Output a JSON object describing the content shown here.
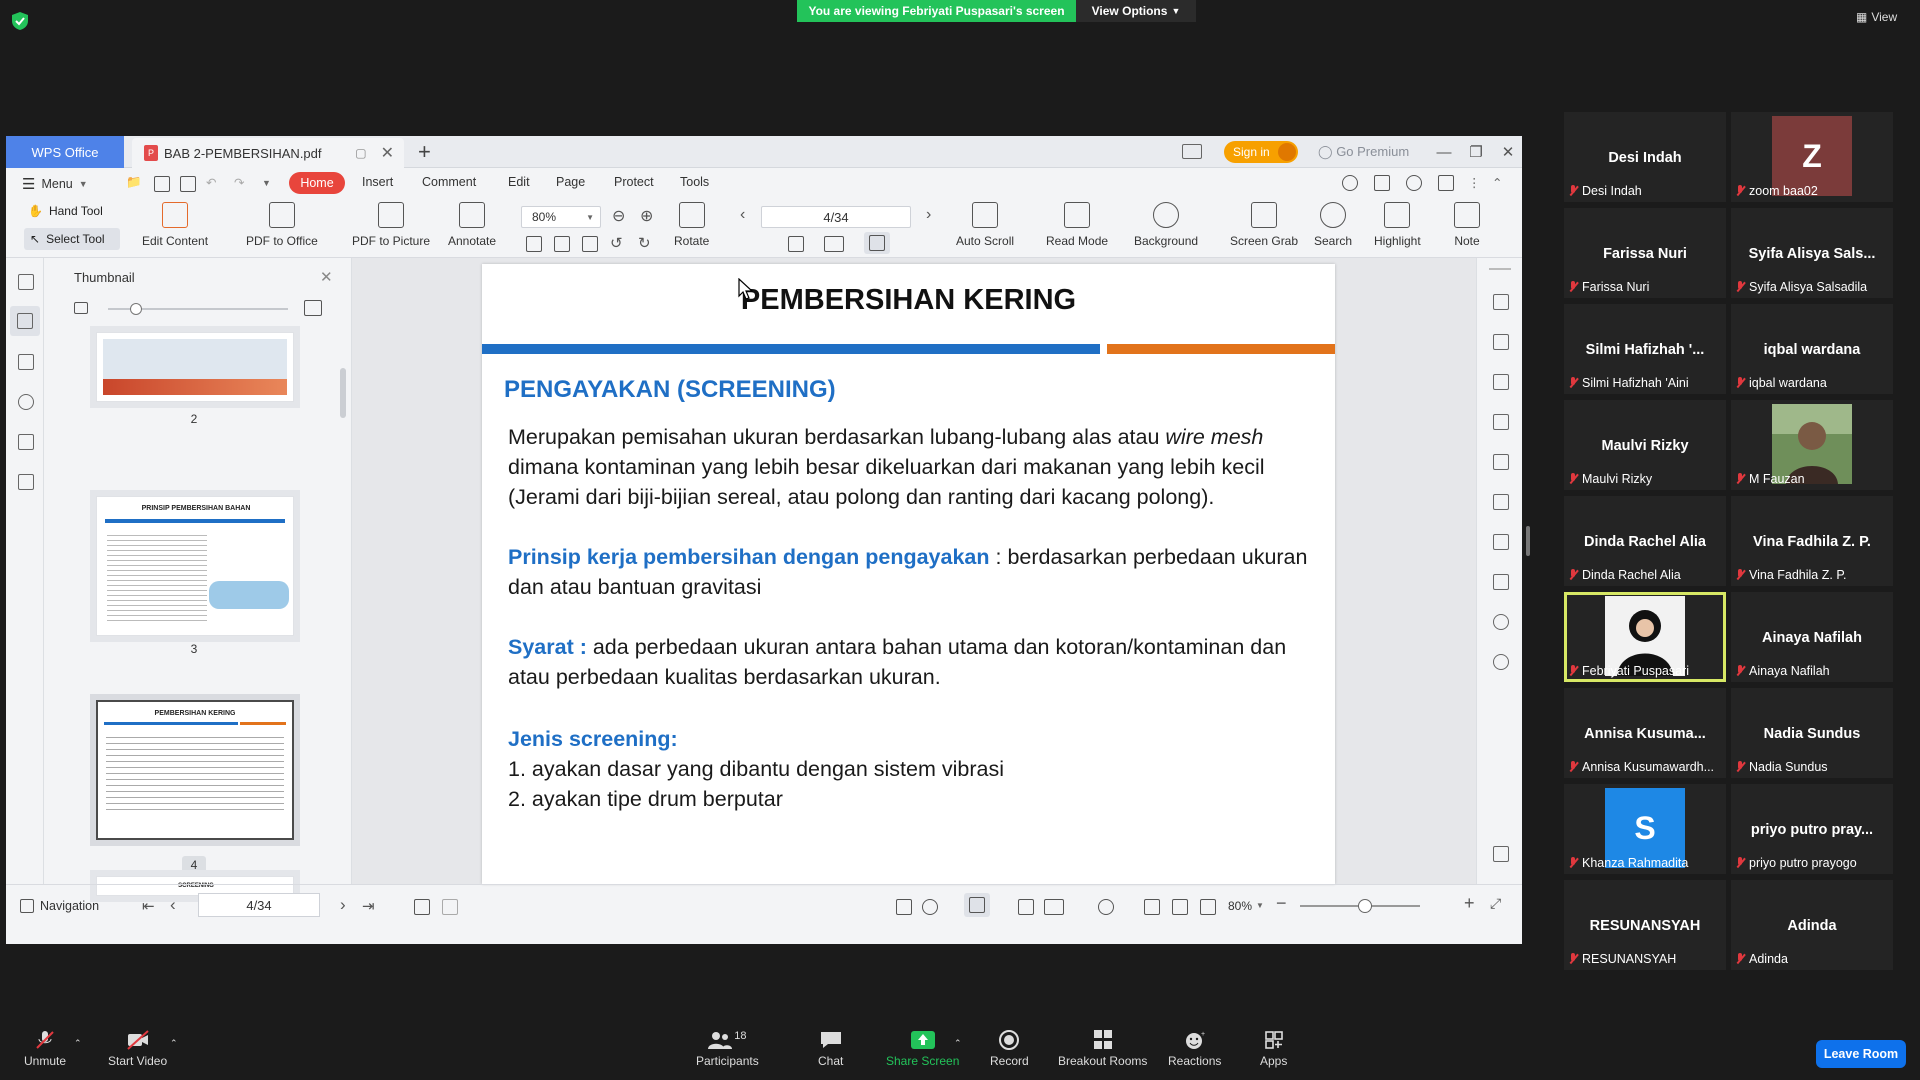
{
  "zoom": {
    "banner": "You are viewing Febriyati Puspasari's screen",
    "view_options": "View Options",
    "view_label": "View",
    "toolbar": {
      "unmute": "Unmute",
      "start_video": "Start Video",
      "participants": "Participants",
      "participants_count": "18",
      "chat": "Chat",
      "share_screen": "Share Screen",
      "record": "Record",
      "breakout_rooms": "Breakout Rooms",
      "reactions": "Reactions",
      "apps": "Apps",
      "leave_room": "Leave Room"
    },
    "participants": [
      {
        "display": "Desi Indah",
        "label": "Desi Indah"
      },
      {
        "display": "Z",
        "label": "zoom baa02"
      },
      {
        "display": "Farissa Nuri",
        "label": "Farissa Nuri"
      },
      {
        "display": "Syifa Alisya Sals...",
        "label": "Syifa Alisya Salsadila"
      },
      {
        "display": "Silmi Hafizhah '...",
        "label": "Silmi Hafizhah 'Aini"
      },
      {
        "display": "iqbal wardana",
        "label": "iqbal wardana"
      },
      {
        "display": "Maulvi Rizky",
        "label": "Maulvi Rizky"
      },
      {
        "display": "",
        "label": "M Fauzan"
      },
      {
        "display": "Dinda Rachel Alia",
        "label": "Dinda Rachel Alia"
      },
      {
        "display": "Vina Fadhila Z. P.",
        "label": "Vina Fadhila Z. P."
      },
      {
        "display": "",
        "label": "Febriyati Puspasari"
      },
      {
        "display": "Ainaya Nafilah",
        "label": "Ainaya Nafilah"
      },
      {
        "display": "Annisa Kusuma...",
        "label": "Annisa Kusumawardh..."
      },
      {
        "display": "Nadia Sundus",
        "label": "Nadia Sundus"
      },
      {
        "display": "S",
        "label": "Khanza Rahmadita"
      },
      {
        "display": "priyo putro pray...",
        "label": "priyo putro prayogo"
      },
      {
        "display": "RESUNANSYAH",
        "label": "RESUNANSYAH"
      },
      {
        "display": "Adinda",
        "label": "Adinda"
      }
    ]
  },
  "wps": {
    "office_tab": "WPS Office",
    "doc_tab": "BAB 2-PEMBERSIHAN.pdf",
    "sign_in": "Sign in",
    "go_premium": "Go Premium",
    "menu": [
      "Menu",
      "Home",
      "Insert",
      "Comment",
      "Edit",
      "Page",
      "Protect",
      "Tools"
    ],
    "ribbon": {
      "hand_tool": "Hand Tool",
      "select_tool": "Select Tool",
      "edit_content": "Edit Content",
      "pdf_to_office": "PDF to Office",
      "pdf_to_picture": "PDF to Picture",
      "annotate": "Annotate",
      "zoom": "80%",
      "rotate": "Rotate",
      "page": "4/34",
      "auto_scroll": "Auto Scroll",
      "read_mode": "Read Mode",
      "background": "Background",
      "screen_grab": "Screen Grab",
      "search": "Search",
      "highlight": "Highlight",
      "note": "Note"
    },
    "thumbnail_title": "Thumbnail",
    "thumb_labels": [
      "2",
      "3",
      "4"
    ],
    "thumb_titles": [
      "PRINSIP PEMBERSIHAN BAHAN",
      "PEMBERSIHAN KERING",
      "SCREENING"
    ],
    "status": {
      "navigation": "Navigation",
      "page": "4/34",
      "zoom": "80%"
    },
    "page": {
      "title": "PEMBERSIHAN KERING",
      "heading": "PENGAYAKAN (SCREENING)",
      "p1_a": "Merupakan pemisahan ukuran berdasarkan lubang-lubang alas atau ",
      "p1_em": "wire mesh",
      "p1_b": " dimana kontaminan yang lebih besar dikeluarkan dari makanan yang lebih kecil (Jerami dari biji-bijian sereal, atau polong dan ranting dari kacang polong).",
      "p2_label": "Prinsip kerja pembersihan dengan pengayakan",
      "p2_text": " : berdasarkan perbedaan ukuran dan atau bantuan gravitasi",
      "p3_label": "Syarat :",
      "p3_text": " ada perbedaan ukuran antara bahan utama dan kotoran/kontaminan dan atau perbedaan kualitas berdasarkan ukuran.",
      "p4_label": "Jenis screening:",
      "list": [
        "1. ayakan dasar yang dibantu dengan sistem vibrasi",
        "2. ayakan tipe drum berputar"
      ]
    }
  }
}
